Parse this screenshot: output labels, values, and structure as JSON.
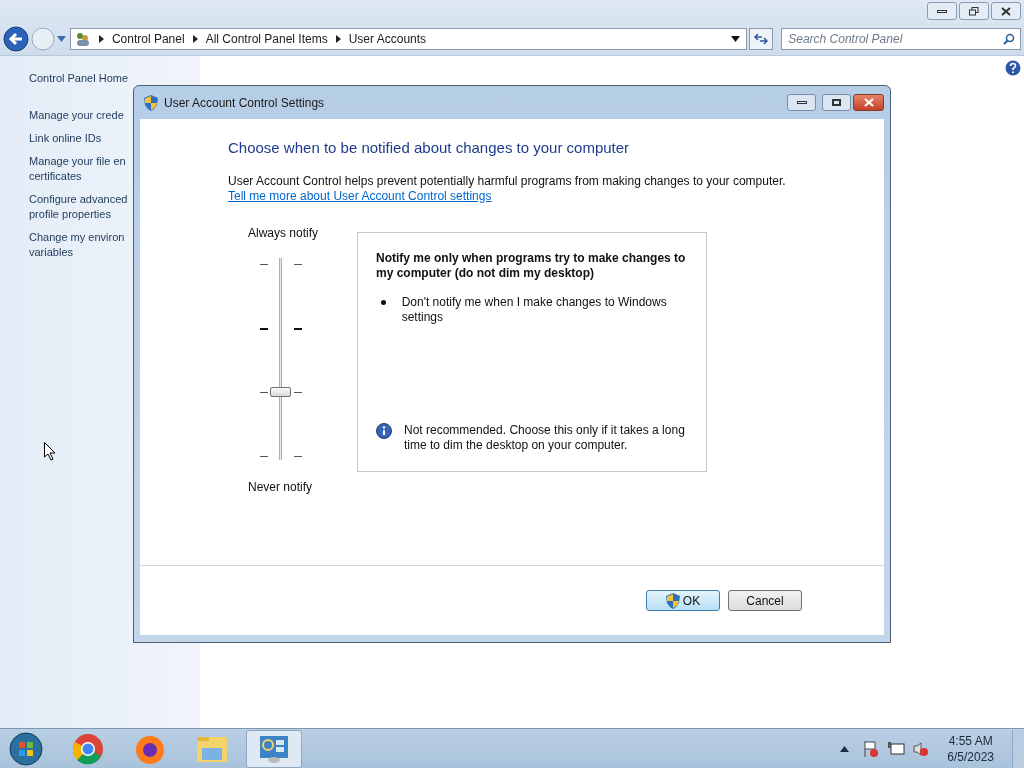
{
  "explorer": {
    "breadcrumb": [
      "Control Panel",
      "All Control Panel Items",
      "User Accounts"
    ],
    "search": {
      "placeholder": "Search Control Panel"
    }
  },
  "sidebar": {
    "items": [
      {
        "lines": [
          "Control Panel Home"
        ]
      },
      {
        "lines": [
          "Manage your crede"
        ]
      },
      {
        "lines": [
          "Link online IDs"
        ]
      },
      {
        "lines": [
          "Manage your file en",
          "certificates"
        ]
      },
      {
        "lines": [
          "Configure advanced",
          "profile properties"
        ]
      },
      {
        "lines": [
          "Change my environ",
          "variables"
        ]
      }
    ]
  },
  "dialog": {
    "title": "User Account Control Settings",
    "heading": "Choose when to be notified about changes to your computer",
    "intro": "User Account Control helps prevent potentially harmful programs from making changes to your computer.",
    "link": "Tell me more about User Account Control settings",
    "slider": {
      "top_label": "Always notify",
      "bottom_label": "Never notify",
      "level": 0.333
    },
    "description": {
      "title": "Notify me only when programs try to make changes to my computer (do not dim my desktop)",
      "bullets": [
        "Don't notify me when I make changes to Windows settings"
      ],
      "note": "Not recommended. Choose this only if it takes a long time to dim the desktop on your computer."
    },
    "buttons": [
      {
        "label": "OK",
        "kind": "default"
      },
      {
        "label": "Cancel",
        "kind": "normal"
      }
    ]
  },
  "taskbar": {
    "time": "4:55 AM",
    "date": "6/5/2023"
  }
}
